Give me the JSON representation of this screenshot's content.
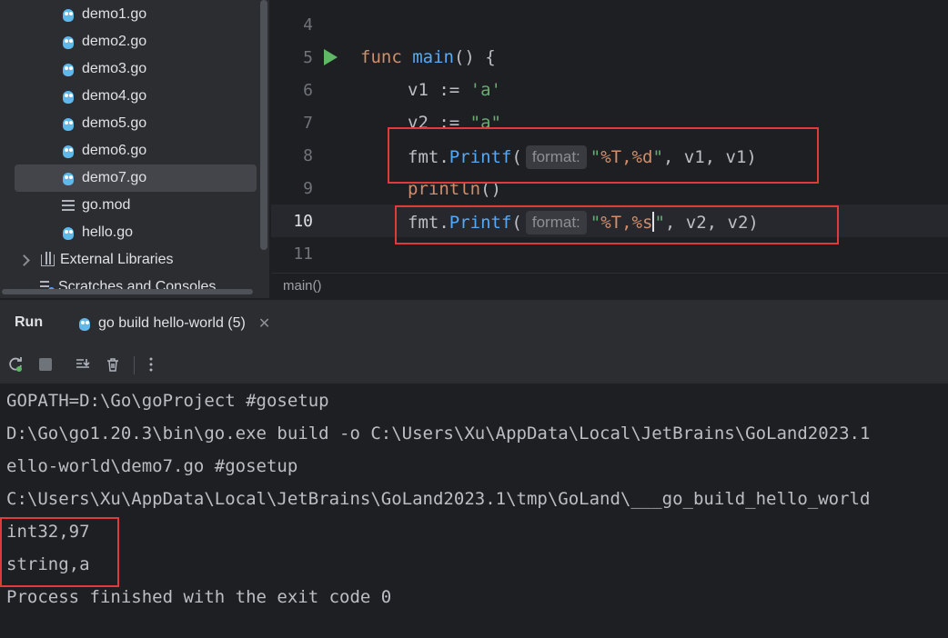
{
  "project": {
    "files": [
      {
        "name": "demo1.go",
        "icon": "gopher-icon"
      },
      {
        "name": "demo2.go",
        "icon": "gopher-icon"
      },
      {
        "name": "demo3.go",
        "icon": "gopher-icon"
      },
      {
        "name": "demo4.go",
        "icon": "gopher-icon"
      },
      {
        "name": "demo5.go",
        "icon": "gopher-icon"
      },
      {
        "name": "demo6.go",
        "icon": "gopher-icon"
      },
      {
        "name": "demo7.go",
        "icon": "gopher-icon",
        "selected": true
      },
      {
        "name": "go.mod",
        "icon": "gomod-icon"
      },
      {
        "name": "hello.go",
        "icon": "gopher-icon"
      }
    ],
    "external_libraries": "External Libraries",
    "scratches": "Scratches and Consoles"
  },
  "editor": {
    "line_numbers": [
      "4",
      "5",
      "6",
      "7",
      "8",
      "9",
      "10",
      "11"
    ],
    "current_line": "10",
    "lines": {
      "l5": {
        "kw": "func",
        "name": "main",
        "rest": "() {"
      },
      "l6": {
        "var": "v1",
        "op": " := ",
        "lit": "'a'"
      },
      "l7": {
        "var": "v2",
        "op": " := ",
        "lit": "\"a\""
      },
      "l8": {
        "pkg": "fmt",
        "dot": ".",
        "call": "Printf",
        "paren": "(",
        "hint": "format:",
        "q1": "\"",
        "fmt": "%T,%d",
        "q2": "\"",
        "args": ", v1, v1)"
      },
      "l9": {
        "call": "println",
        "rest": "()"
      },
      "l10": {
        "pkg": "fmt",
        "dot": ".",
        "call": "Printf",
        "paren": "(",
        "hint": "format:",
        "q1": "\"",
        "fmt_a": "%T,%s",
        "q2": "\"",
        "args": ", v2, v2)"
      }
    },
    "breadcrumb": "main()"
  },
  "run_panel": {
    "title": "Run",
    "tab_label": "go build hello-world (5)",
    "close_glyph": "✕",
    "toolbar_icons": [
      "rerun-icon",
      "stop-icon",
      "scroll-to-end-icon",
      "clear-icon",
      "more-icon"
    ]
  },
  "console": {
    "lines": [
      "GOPATH=D:\\Go\\goProject #gosetup",
      "D:\\Go\\go1.20.3\\bin\\go.exe build -o C:\\Users\\Xu\\AppData\\Local\\JetBrains\\GoLand2023.1",
      "ello-world\\demo7.go #gosetup",
      "C:\\Users\\Xu\\AppData\\Local\\JetBrains\\GoLand2023.1\\tmp\\GoLand\\___go_build_hello_world",
      "int32,97",
      "string,a",
      "Process finished with the exit code 0"
    ]
  },
  "colors": {
    "highlight_box": "#e03b3b",
    "background": "#1e1f22",
    "panel": "#2b2d30"
  }
}
